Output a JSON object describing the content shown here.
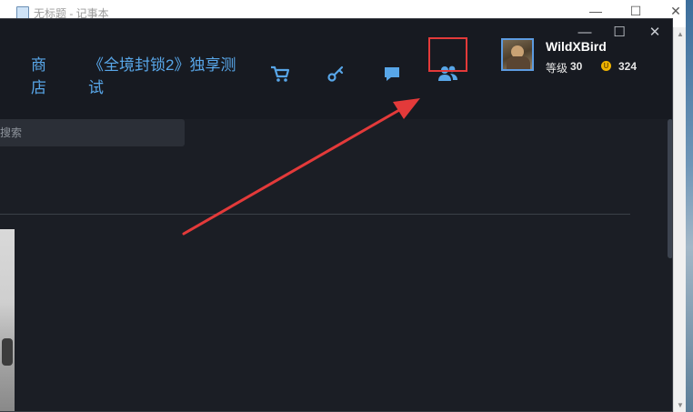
{
  "notepad": {
    "title": "无标题 - 记事本",
    "controls": {
      "minimize": "—",
      "maximize": "☐",
      "close": "✕"
    }
  },
  "window_controls": {
    "minimize": "—",
    "maximize": "☐",
    "close": "✕"
  },
  "nav": {
    "store_label": "商店",
    "beta_label": "《全境封锁2》独享测试",
    "icons": [
      "cart-icon",
      "key-icon",
      "chat-icon",
      "friends-icon"
    ]
  },
  "user": {
    "name": "WildXBird",
    "level_label": "等级",
    "level": "30",
    "points": "324",
    "coin_glyph": "U"
  },
  "search": {
    "placeholder": "搜索",
    "value": ""
  },
  "colors": {
    "accent": "#58a6e8",
    "background": "#1b1e25",
    "topbar": "#171a21",
    "highlight_box": "#e33a3a",
    "arrow": "#e33a3a",
    "coin": "#f0b400"
  }
}
